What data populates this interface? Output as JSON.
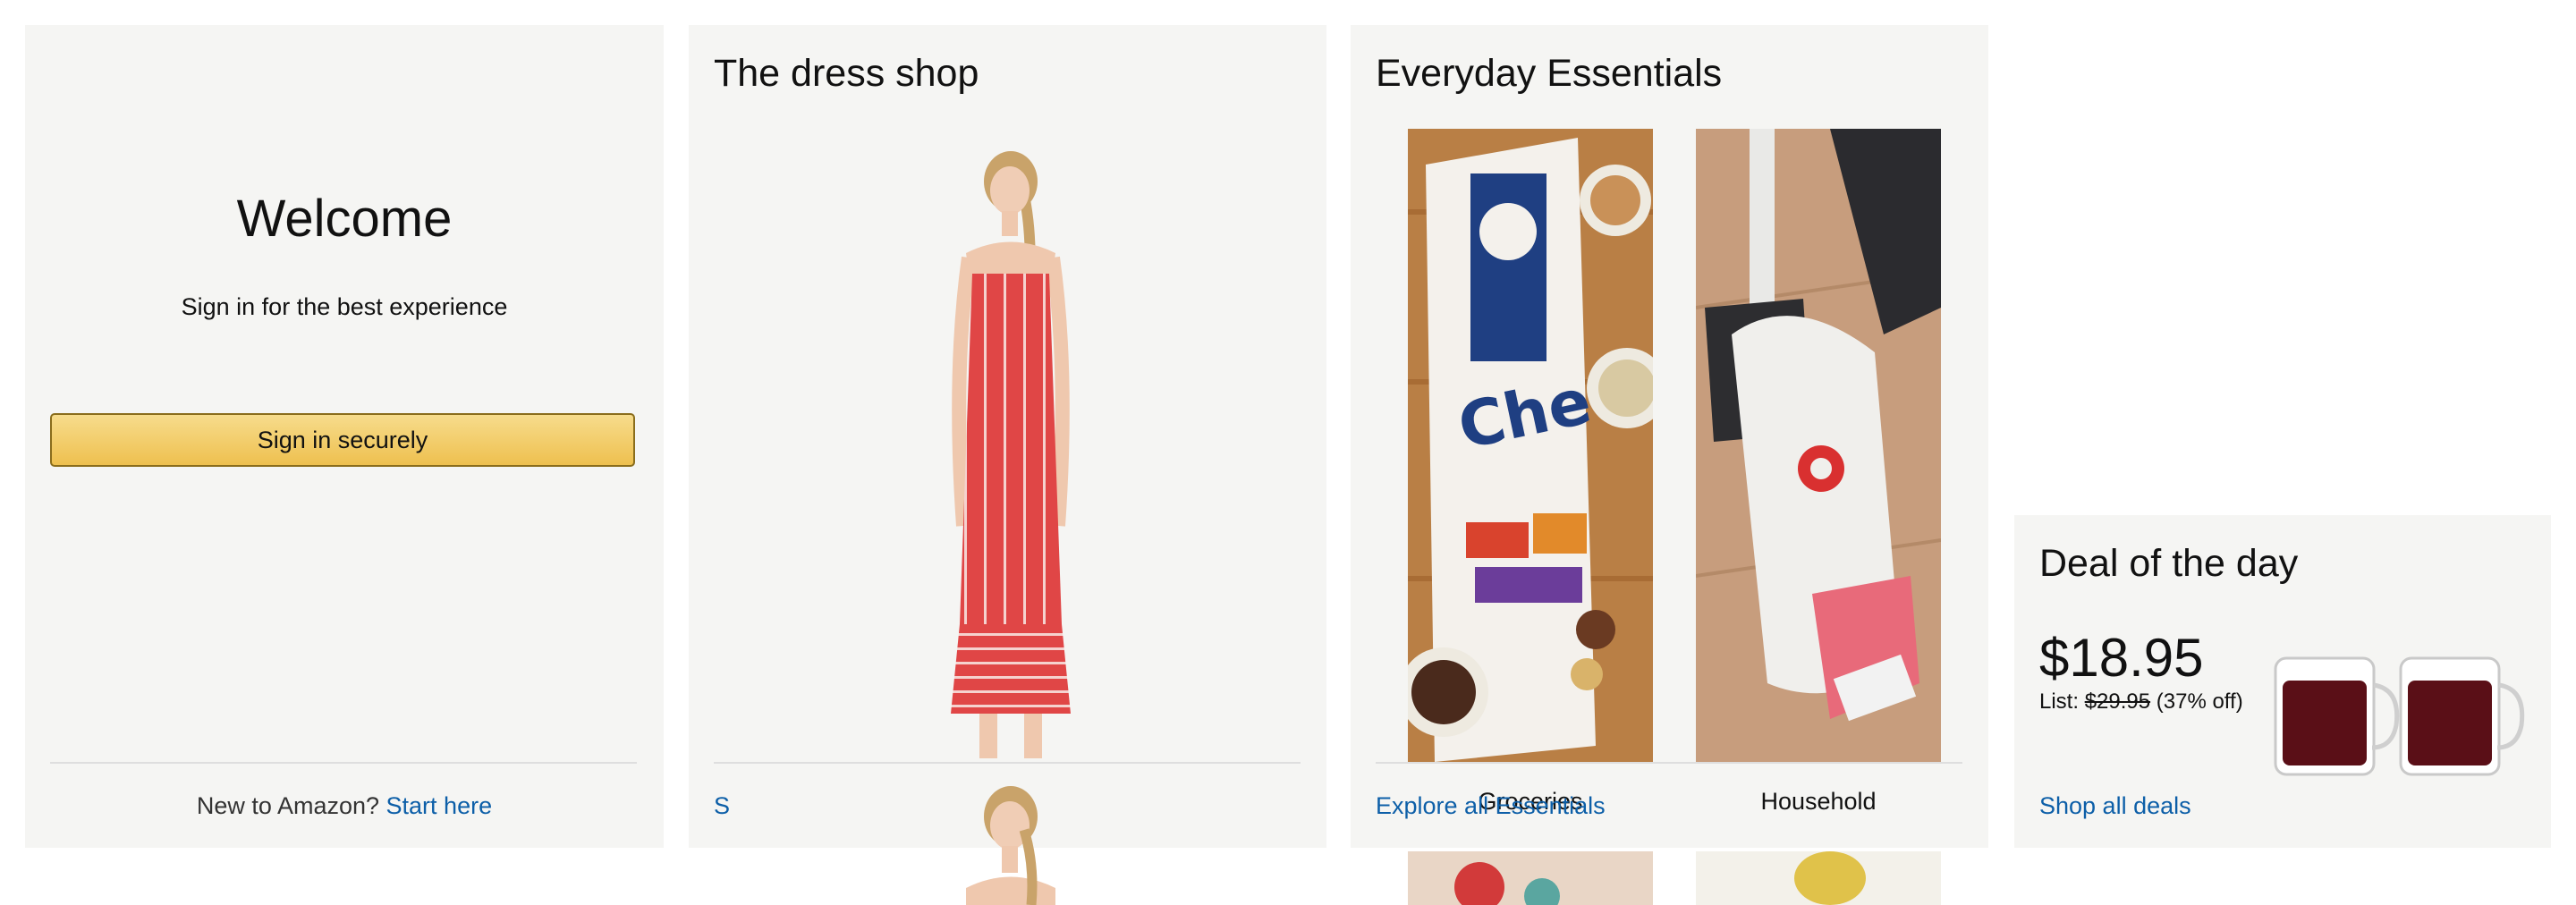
{
  "welcome": {
    "heading": "Welcome",
    "subtitle": "Sign in for the best experience",
    "signin_button": "Sign in securely",
    "new_text": "New to Amazon?",
    "start_link": "Start here"
  },
  "dress_shop": {
    "title": "The dress shop",
    "footer_link": "S"
  },
  "essentials": {
    "title": "Everyday Essentials",
    "items": [
      {
        "label": "Groceries",
        "image": "cereal-box-image"
      },
      {
        "label": "Household",
        "image": "broom-dustpan-image"
      }
    ],
    "footer_link": "Explore all Essentials"
  },
  "deal": {
    "title": "Deal of the day",
    "price": "$18.95",
    "list_prefix": "List:",
    "list_price": "$29.95",
    "discount": "(37% off)",
    "footer_link": "Shop all deals"
  },
  "colors": {
    "card_bg": "#f5f5f3",
    "link": "#0d5fa8",
    "button_top": "#f7dc8c",
    "button_bottom": "#eec04f",
    "dress_red": "#e04646"
  }
}
